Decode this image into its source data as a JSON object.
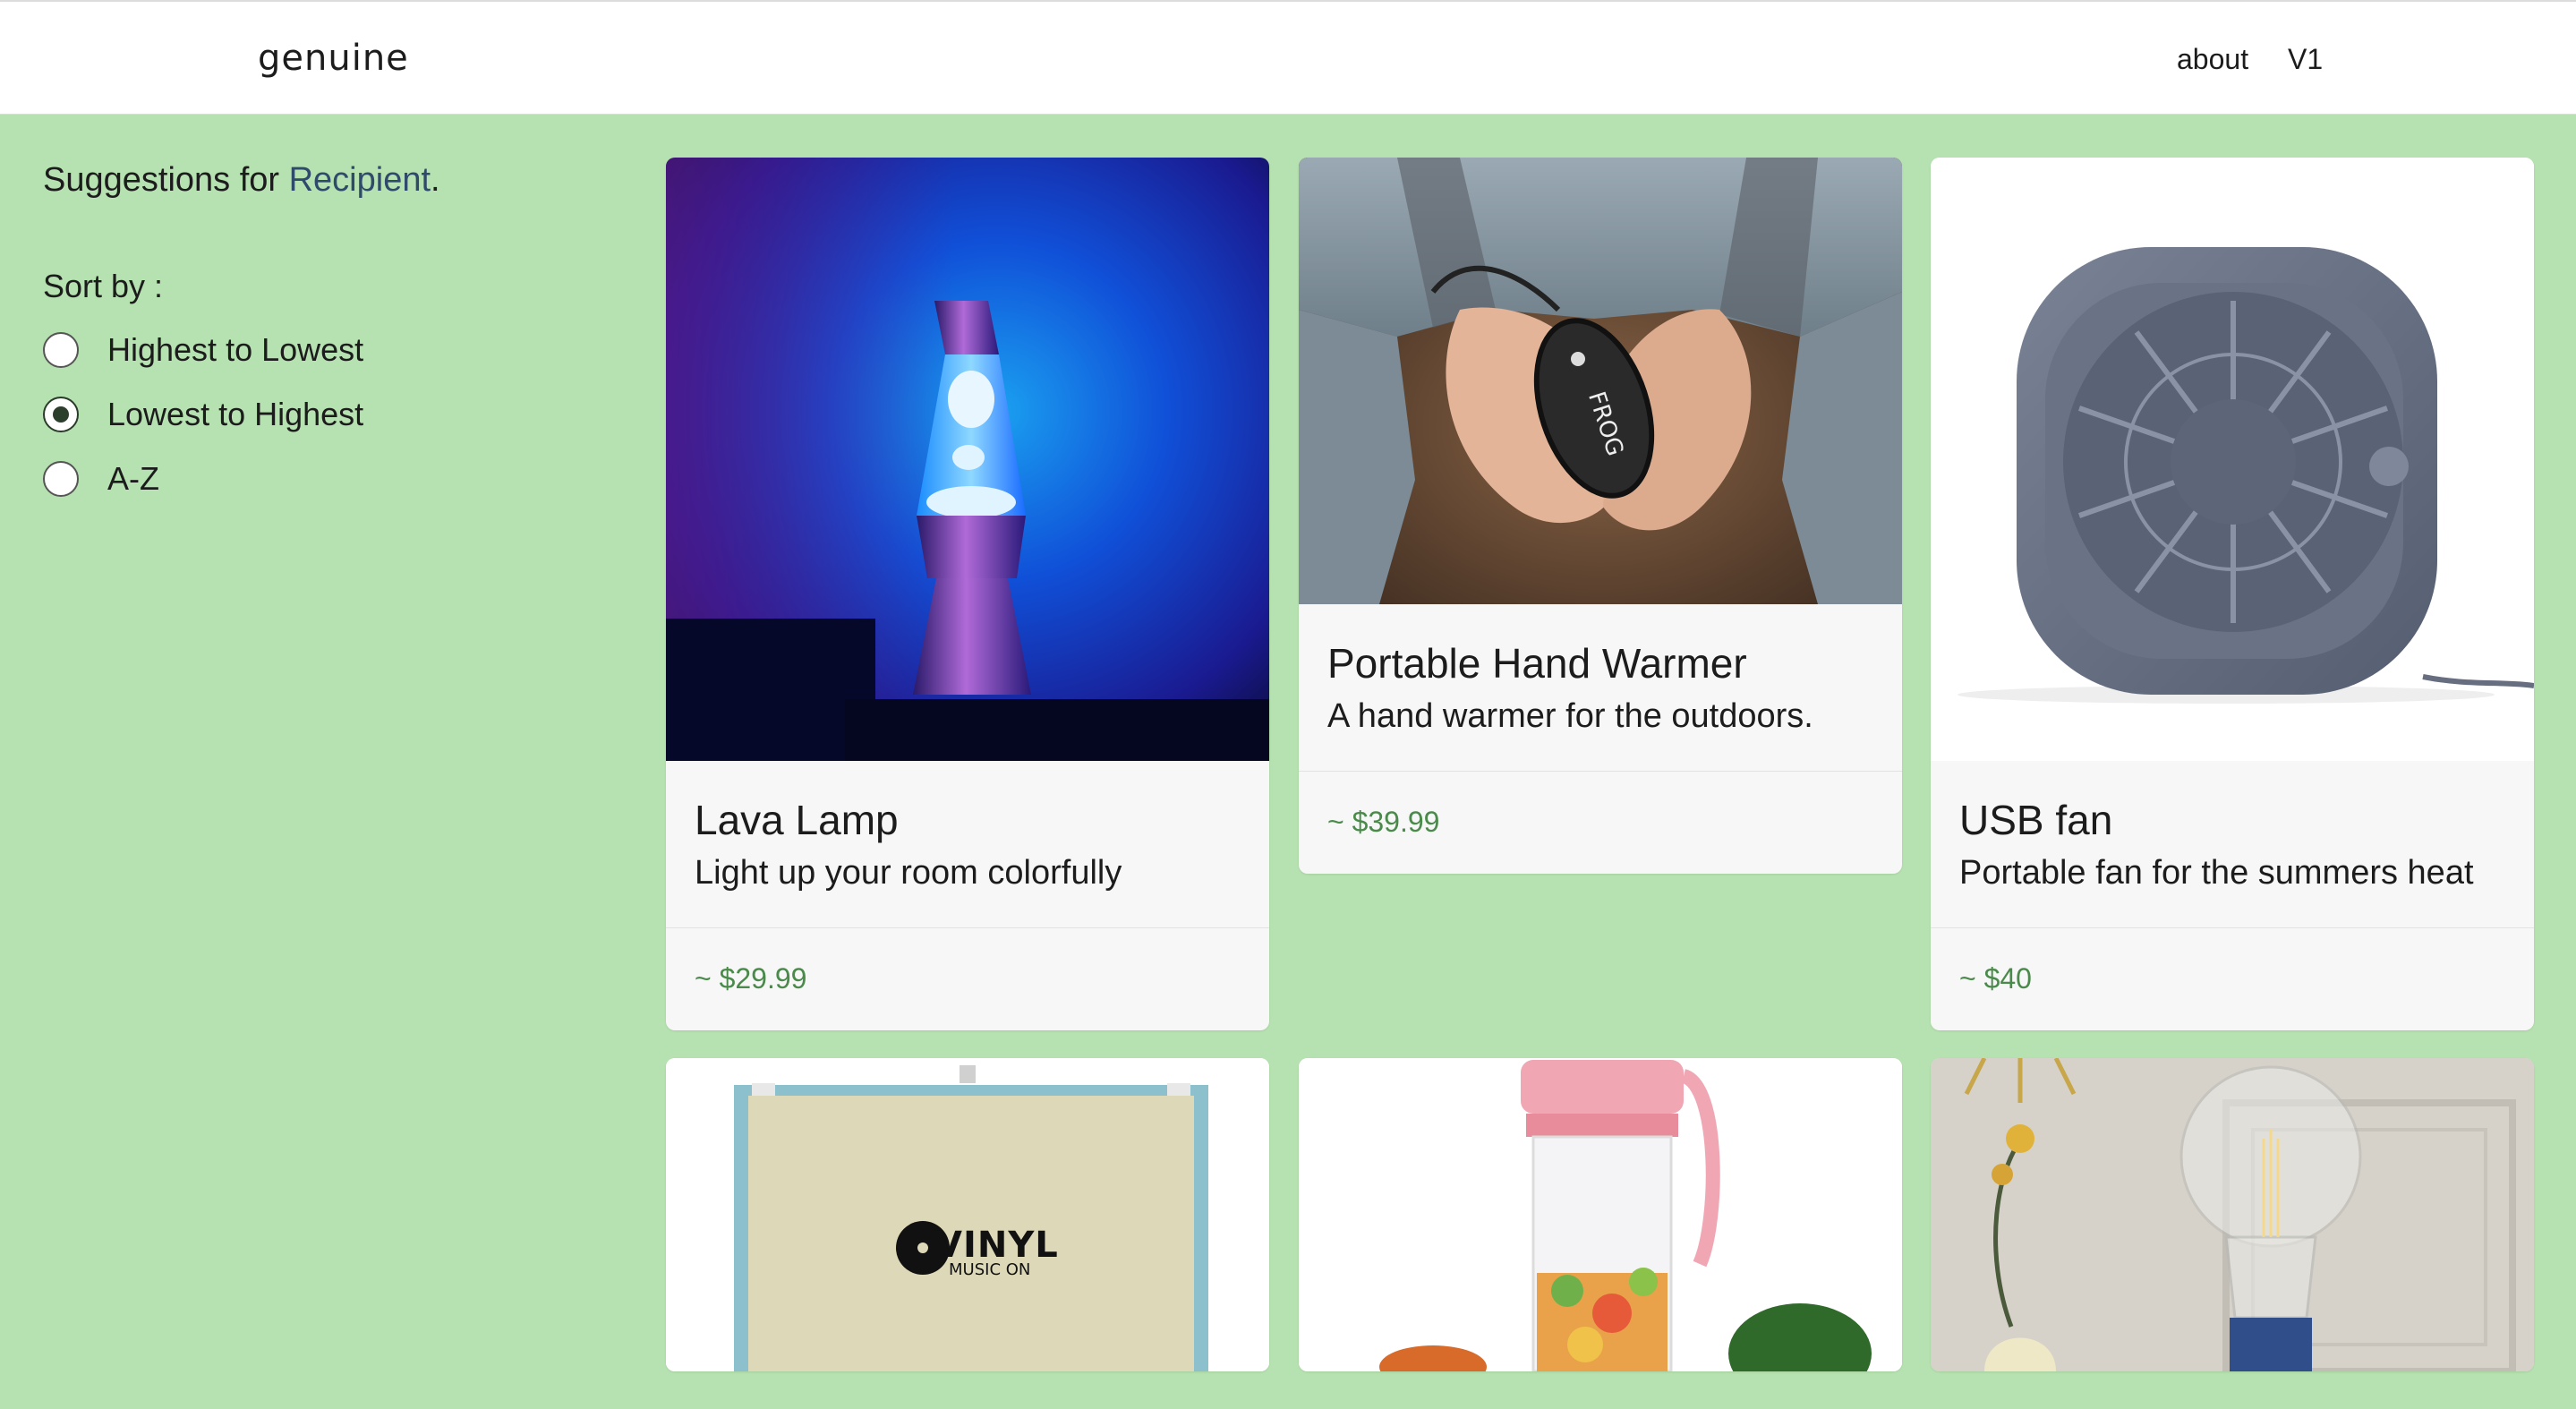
{
  "nav": {
    "brand": "genuine",
    "about": "about",
    "version": "V1"
  },
  "sidebar": {
    "suggestions_prefix": "Suggestions for ",
    "recipient": "Recipient",
    "suggestions_suffix": ".",
    "sort_label": "Sort by :",
    "sort_options": [
      {
        "label": "Highest to Lowest",
        "checked": false
      },
      {
        "label": "Lowest to Highest",
        "checked": true
      },
      {
        "label": "A-Z",
        "checked": false
      }
    ]
  },
  "products": [
    {
      "title": "Lava Lamp",
      "description": "Light up your room colorfully",
      "price": "~ $29.99",
      "image": "lava-lamp-image"
    },
    {
      "title": "Portable Hand Warmer",
      "description": "A hand warmer for the outdoors.",
      "price": "~ $39.99",
      "image": "hand-warmer-image"
    },
    {
      "title": "USB fan",
      "description": "Portable fan for the summers heat",
      "price": "~ $40",
      "image": "usb-fan-image"
    },
    {
      "image": "vinyl-player-image",
      "logo_text": "VINYL",
      "logo_sub": "MUSIC ON"
    },
    {
      "image": "portable-blender-image"
    },
    {
      "image": "light-bulb-image"
    }
  ],
  "colors": {
    "background": "#b6e1b0",
    "price": "#4a8a4a",
    "recipient": "#2f4a6a"
  }
}
